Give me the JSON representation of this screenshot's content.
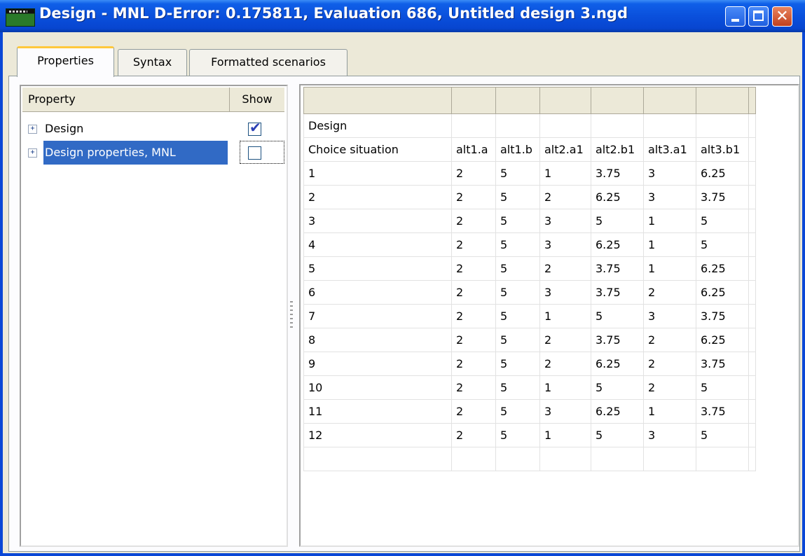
{
  "window": {
    "title": "Design  -  MNL D-Error: 0.175811,  Evaluation 686,  Untitled design 3.ngd",
    "icon": "app-icon",
    "minimize_glyph": "",
    "maximize_glyph": "",
    "close_glyph": "✕"
  },
  "tabs": [
    {
      "label": "Properties",
      "active": true
    },
    {
      "label": "Syntax",
      "active": false
    },
    {
      "label": "Formatted scenarios",
      "active": false
    }
  ],
  "properties_panel": {
    "col_property": "Property",
    "col_show": "Show",
    "items": [
      {
        "label": "Design",
        "expander": "+",
        "checked": true
      },
      {
        "label": "Design properties, MNL",
        "expander": "+",
        "checked": false,
        "selected": true
      }
    ]
  },
  "design_grid": {
    "title_row": "Design",
    "columns": [
      "Choice situation",
      "alt1.a",
      "alt1.b",
      "alt2.a1",
      "alt2.b1",
      "alt3.a1",
      "alt3.b1"
    ],
    "rows": [
      [
        "1",
        "2",
        "5",
        "1",
        "3.75",
        "3",
        "6.25"
      ],
      [
        "2",
        "2",
        "5",
        "2",
        "6.25",
        "3",
        "3.75"
      ],
      [
        "3",
        "2",
        "5",
        "3",
        "5",
        "1",
        "5"
      ],
      [
        "4",
        "2",
        "5",
        "3",
        "6.25",
        "1",
        "5"
      ],
      [
        "5",
        "2",
        "5",
        "2",
        "3.75",
        "1",
        "6.25"
      ],
      [
        "6",
        "2",
        "5",
        "3",
        "3.75",
        "2",
        "6.25"
      ],
      [
        "7",
        "2",
        "5",
        "1",
        "5",
        "3",
        "3.75"
      ],
      [
        "8",
        "2",
        "5",
        "2",
        "3.75",
        "2",
        "6.25"
      ],
      [
        "9",
        "2",
        "5",
        "2",
        "6.25",
        "2",
        "3.75"
      ],
      [
        "10",
        "2",
        "5",
        "1",
        "5",
        "2",
        "5"
      ],
      [
        "11",
        "2",
        "5",
        "3",
        "6.25",
        "1",
        "3.75"
      ],
      [
        "12",
        "2",
        "5",
        "1",
        "5",
        "3",
        "5"
      ]
    ]
  }
}
